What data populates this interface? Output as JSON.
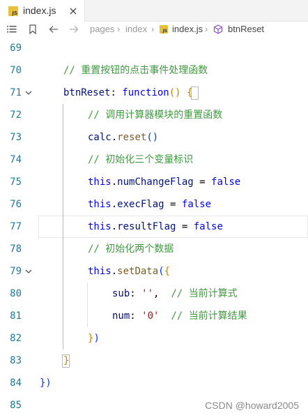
{
  "tab": {
    "badge": "JS",
    "label": "index.js"
  },
  "breadcrumbs": {
    "items": [
      {
        "label": "pages"
      },
      {
        "label": "index"
      },
      {
        "label": "index.js"
      },
      {
        "label": "btnReset"
      }
    ]
  },
  "editor": {
    "lines": [
      {
        "number": "69",
        "tokens": []
      },
      {
        "number": "70",
        "tokens": [
          {
            "text": "// 重置按钮的点击事件处理函数",
            "type": "comment"
          }
        ]
      },
      {
        "number": "71",
        "tokens": [
          {
            "text": "btnReset",
            "type": "prop"
          },
          {
            "text": ": ",
            "type": "punc"
          },
          {
            "text": "function",
            "type": "key"
          },
          {
            "text": "() ",
            "type": "bracket"
          },
          {
            "text": "{",
            "type": "bracket"
          }
        ]
      },
      {
        "number": "72",
        "tokens": [
          {
            "text": "// 调用计算器模块的重置函数",
            "type": "comment"
          }
        ]
      },
      {
        "number": "73",
        "tokens": [
          {
            "text": "calc",
            "type": "prop"
          },
          {
            "text": ".",
            "type": "punc"
          },
          {
            "text": "reset",
            "type": "fn"
          },
          {
            "text": "()",
            "type": "bracket2"
          }
        ]
      },
      {
        "number": "74",
        "tokens": [
          {
            "text": "// 初始化三个变量标识",
            "type": "comment"
          }
        ]
      },
      {
        "number": "75",
        "tokens": [
          {
            "text": "this",
            "type": "key"
          },
          {
            "text": ".",
            "type": "punc"
          },
          {
            "text": "numChangeFlag",
            "type": "prop"
          },
          {
            "text": " = ",
            "type": "punc"
          },
          {
            "text": "false",
            "type": "key"
          }
        ]
      },
      {
        "number": "76",
        "tokens": [
          {
            "text": "this",
            "type": "key"
          },
          {
            "text": ".",
            "type": "punc"
          },
          {
            "text": "execFlag",
            "type": "prop"
          },
          {
            "text": " = ",
            "type": "punc"
          },
          {
            "text": "false",
            "type": "key"
          }
        ]
      },
      {
        "number": "77",
        "tokens": [
          {
            "text": "this",
            "type": "key"
          },
          {
            "text": ".",
            "type": "punc"
          },
          {
            "text": "resultFlag",
            "type": "prop"
          },
          {
            "text": " = ",
            "type": "punc"
          },
          {
            "text": "false",
            "type": "key"
          }
        ]
      },
      {
        "number": "78",
        "tokens": [
          {
            "text": "// 初始化两个数据",
            "type": "comment"
          }
        ]
      },
      {
        "number": "79",
        "tokens": [
          {
            "text": "this",
            "type": "key"
          },
          {
            "text": ".",
            "type": "punc"
          },
          {
            "text": "setData",
            "type": "fn"
          },
          {
            "text": "(",
            "type": "bracket2"
          },
          {
            "text": "{",
            "type": "bracket"
          }
        ]
      },
      {
        "number": "80",
        "tokens": [
          {
            "text": "sub",
            "type": "prop"
          },
          {
            "text": ": ",
            "type": "punc"
          },
          {
            "text": "''",
            "type": "str"
          },
          {
            "text": ",  ",
            "type": "punc"
          },
          {
            "text": "// 当前计算式",
            "type": "comment"
          }
        ]
      },
      {
        "number": "81",
        "tokens": [
          {
            "text": "num",
            "type": "prop"
          },
          {
            "text": ": ",
            "type": "punc"
          },
          {
            "text": "'0'",
            "type": "str"
          },
          {
            "text": "  ",
            "type": "punc"
          },
          {
            "text": "// 当前计算结果",
            "type": "comment"
          }
        ]
      },
      {
        "number": "82",
        "tokens": [
          {
            "text": "}",
            "type": "bracket"
          },
          {
            "text": ")",
            "type": "bracket2"
          }
        ]
      },
      {
        "number": "83",
        "tokens": [
          {
            "text": "}",
            "type": "bracket"
          }
        ]
      },
      {
        "number": "84",
        "tokens": [
          {
            "text": "})",
            "type": "bracket2"
          }
        ]
      },
      {
        "number": "85",
        "tokens": []
      }
    ]
  },
  "watermark": "CSDN @howard2005",
  "colors": {
    "comment": "#3f9a3f",
    "keyword": "#0000ff",
    "property": "#001080",
    "function": "#795e26",
    "string": "#a31515",
    "bracket_gold": "#c18401",
    "bracket_blue": "#0431fa",
    "line_number": "#237893"
  }
}
